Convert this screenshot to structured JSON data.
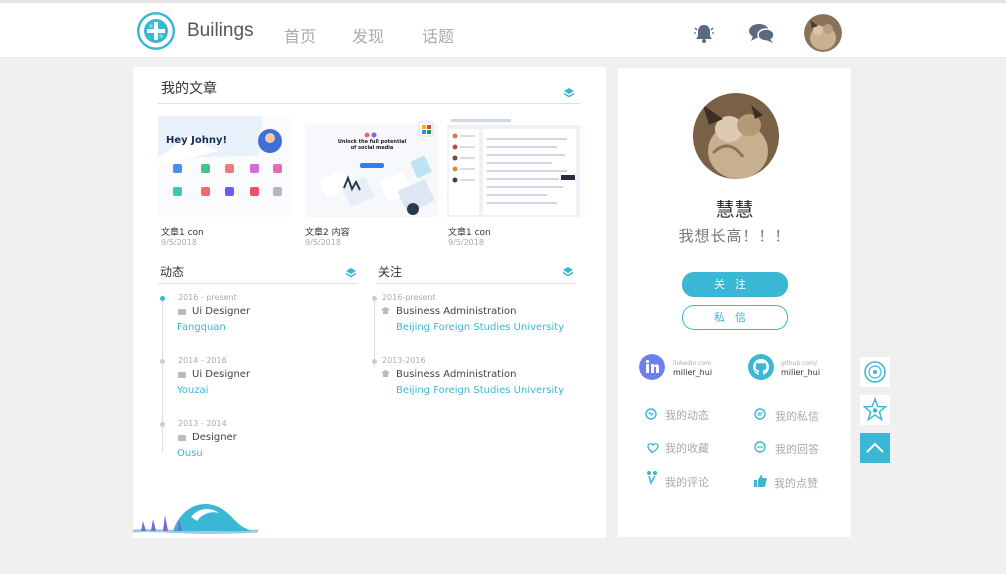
{
  "header": {
    "brand": "Builings",
    "nav": [
      "首页",
      "发现",
      "话题"
    ],
    "colors": {
      "accent": "#3ab7d4"
    }
  },
  "articles": {
    "title": "我的文章",
    "items": [
      {
        "title": "文章1 con",
        "date": "9/5/2018",
        "thumb_text": "Hey Johny!"
      },
      {
        "title": "文章2 内容",
        "date": "9/5/2018",
        "thumb_text": "Unlock the full potential of social media"
      },
      {
        "title": "文章1 con",
        "date": "9/5/2018"
      }
    ]
  },
  "activity": {
    "title": "动态",
    "items": [
      {
        "date": "2016 - present",
        "role": "Ui Designer",
        "org": "Fangquan"
      },
      {
        "date": "2014 - 2016",
        "role": "Ui Designer",
        "org": "Youzai"
      },
      {
        "date": "2013 - 2014",
        "role": "Designer",
        "org": "Ousu"
      }
    ]
  },
  "following": {
    "title": "关注",
    "items": [
      {
        "date": "2016-present",
        "role": "Business Administration",
        "org": "Beijing Foreign Studies University"
      },
      {
        "date": "2013-2016",
        "role": "Business Administration",
        "org": "Beijing Foreign Studies University"
      }
    ]
  },
  "profile": {
    "name": "慧慧",
    "motto": "我想长高！！！",
    "follow_label": "关注",
    "message_label": "私信",
    "social": [
      {
        "icon": "linkedin-icon",
        "site": "linkedin.com",
        "user": "milier_hui"
      },
      {
        "icon": "github-icon",
        "site": "github.com/",
        "user": "milier_hui"
      }
    ],
    "menu": [
      {
        "icon": "dynamic-icon",
        "label": "我的动态"
      },
      {
        "icon": "private-message-icon",
        "label": "我的私信"
      },
      {
        "icon": "favorite-icon",
        "label": "我的收藏"
      },
      {
        "icon": "answer-icon",
        "label": "我的回答"
      },
      {
        "icon": "comment-icon",
        "label": "我的评论"
      },
      {
        "icon": "like-icon",
        "label": "我的点赞"
      }
    ]
  },
  "floating": [
    "disc-icon",
    "star-icon",
    "back-to-top-icon"
  ]
}
